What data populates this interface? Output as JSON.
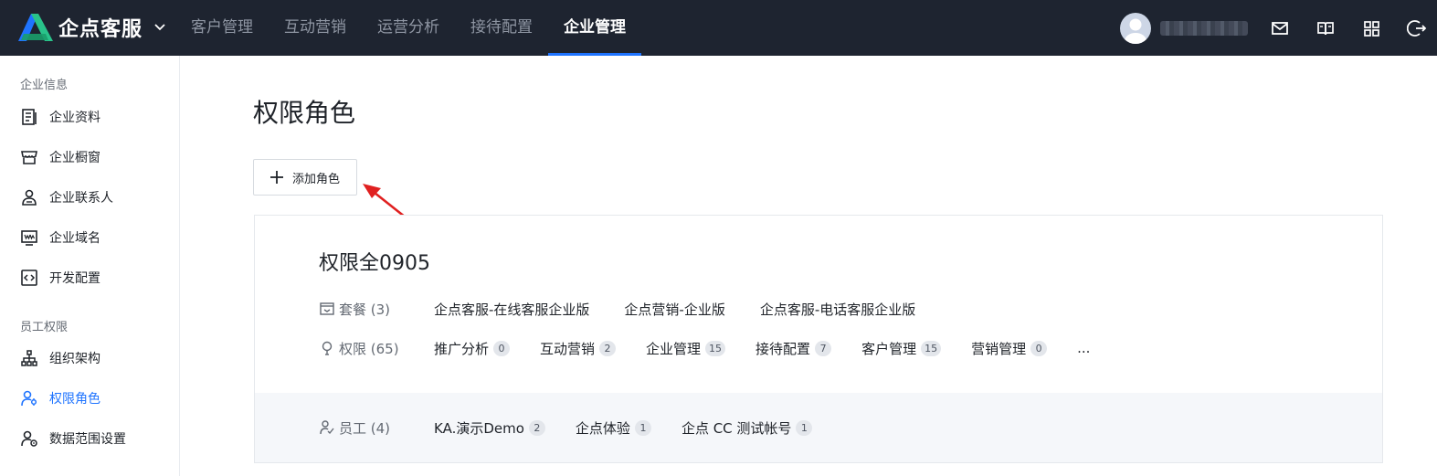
{
  "topbar": {
    "brand_name": "企点客服",
    "nav": [
      {
        "label": "客户管理",
        "active": false
      },
      {
        "label": "互动营销",
        "active": false
      },
      {
        "label": "运营分析",
        "active": false
      },
      {
        "label": "接待配置",
        "active": false
      },
      {
        "label": "企业管理",
        "active": true
      }
    ],
    "icons": [
      "mail-icon",
      "book-icon",
      "grid-icon",
      "logout-icon"
    ]
  },
  "sidebar": {
    "sections": [
      {
        "title": "企业信息",
        "items": [
          {
            "label": "企业资料",
            "icon": "document-icon"
          },
          {
            "label": "企业橱窗",
            "icon": "storefront-icon"
          },
          {
            "label": "企业联系人",
            "icon": "contact-icon"
          },
          {
            "label": "企业域名",
            "icon": "domain-icon"
          },
          {
            "label": "开发配置",
            "icon": "code-icon"
          }
        ]
      },
      {
        "title": "员工权限",
        "items": [
          {
            "label": "组织架构",
            "icon": "org-chart-icon"
          },
          {
            "label": "权限角色",
            "icon": "role-icon",
            "active": true
          },
          {
            "label": "数据范围设置",
            "icon": "data-scope-icon"
          }
        ]
      }
    ]
  },
  "main": {
    "title": "权限角色",
    "add_button": "添加角色",
    "role": {
      "name": "权限全0905",
      "packages_label": "套餐 (3)",
      "packages": [
        "企点客服-在线客服企业版",
        "企点营销-企业版",
        "企点客服-电话客服企业版"
      ],
      "permissions_label": "权限 (65)",
      "permissions": [
        {
          "name": "推广分析",
          "count": "0"
        },
        {
          "name": "互动营销",
          "count": "2"
        },
        {
          "name": "企业管理",
          "count": "15"
        },
        {
          "name": "接待配置",
          "count": "7"
        },
        {
          "name": "客户管理",
          "count": "15"
        },
        {
          "name": "营销管理",
          "count": "0"
        }
      ],
      "permissions_more": "...",
      "employees_label": "员工 (4)",
      "employees": [
        {
          "name": "KA.演示Demo",
          "count": "2"
        },
        {
          "name": "企点体验",
          "count": "1"
        },
        {
          "name": "企点 CC 测试帐号",
          "count": "1"
        }
      ]
    }
  },
  "colors": {
    "topbar": "#1e2430",
    "accent": "#1f74ff",
    "annotation_arrow": "#e02020"
  }
}
